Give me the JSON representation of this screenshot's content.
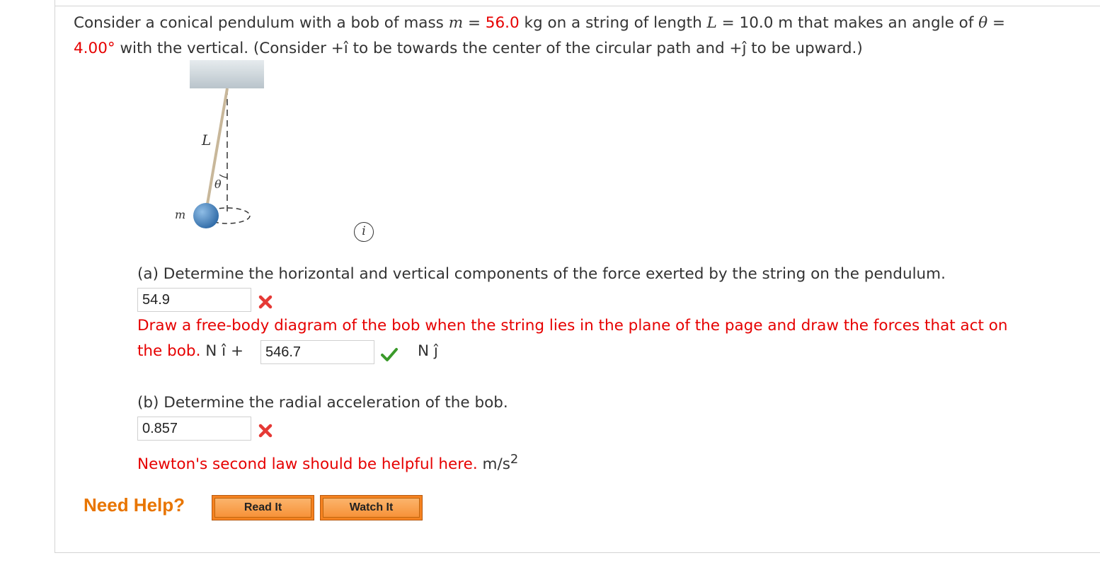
{
  "problem": {
    "intro": "Consider a conical pendulum with a bob of mass ",
    "m_var": "m",
    "eq1": " = ",
    "mass_value": "56.0",
    "after_mass": " kg on a string of length ",
    "L_var": "L",
    "eq2": " = 10.0 m that makes an angle of ",
    "theta_var": "θ",
    "eq3": " =",
    "angle_value": "4.00°",
    "rest": " with the vertical. (Consider +î to be towards the center of the circular path and +ĵ to be upward.)"
  },
  "figure": {
    "length_label": "L",
    "angle_label": "θ",
    "mass_label": "m",
    "colors": {
      "ceiling": "#cdd6dc",
      "string": "#c8b79a",
      "bob": "#4a86c5"
    }
  },
  "part_a": {
    "question": "(a) Determine the horizontal and vertical components of the force exerted by the string on the pendulum.",
    "answer1": "54.9",
    "answer1_status": "incorrect",
    "feedback": "Draw a free-body diagram of the bob when the string lies in the plane of the page and draw the forces that act on",
    "feedback_cont": "the bob.",
    "unit_i": "N î +",
    "answer2": "546.7",
    "answer2_status": "correct",
    "unit_j": "N ĵ"
  },
  "part_b": {
    "question": "(b) Determine the radial acceleration of the bob.",
    "answer": "0.857",
    "answer_status": "incorrect",
    "feedback": "Newton's second law should be helpful here.",
    "unit": "m/s",
    "unit_exp": "2"
  },
  "help": {
    "label": "Need Help?",
    "read_it": "Read It",
    "watch_it": "Watch It"
  },
  "colors": {
    "red": "#e60000",
    "correct": "#3a9a2a",
    "help_orange": "#e87500"
  }
}
